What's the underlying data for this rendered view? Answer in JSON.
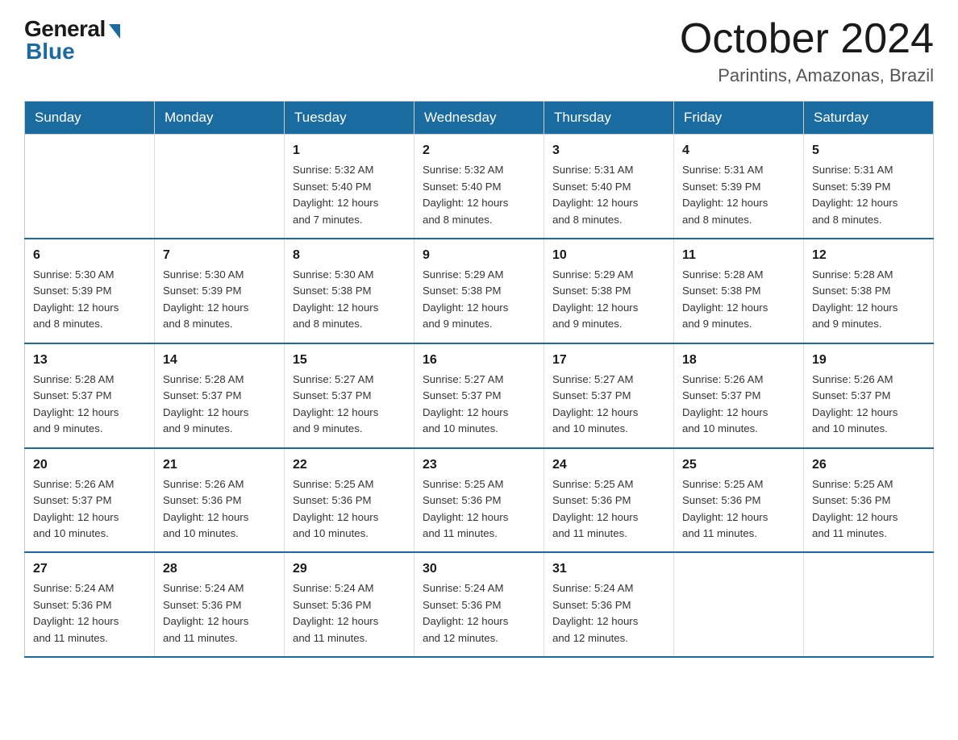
{
  "header": {
    "logo": {
      "general": "General",
      "blue": "Blue"
    },
    "title": "October 2024",
    "location": "Parintins, Amazonas, Brazil"
  },
  "calendar": {
    "days_of_week": [
      "Sunday",
      "Monday",
      "Tuesday",
      "Wednesday",
      "Thursday",
      "Friday",
      "Saturday"
    ],
    "weeks": [
      [
        {
          "day": "",
          "info": ""
        },
        {
          "day": "",
          "info": ""
        },
        {
          "day": "1",
          "info": "Sunrise: 5:32 AM\nSunset: 5:40 PM\nDaylight: 12 hours\nand 7 minutes."
        },
        {
          "day": "2",
          "info": "Sunrise: 5:32 AM\nSunset: 5:40 PM\nDaylight: 12 hours\nand 8 minutes."
        },
        {
          "day": "3",
          "info": "Sunrise: 5:31 AM\nSunset: 5:40 PM\nDaylight: 12 hours\nand 8 minutes."
        },
        {
          "day": "4",
          "info": "Sunrise: 5:31 AM\nSunset: 5:39 PM\nDaylight: 12 hours\nand 8 minutes."
        },
        {
          "day": "5",
          "info": "Sunrise: 5:31 AM\nSunset: 5:39 PM\nDaylight: 12 hours\nand 8 minutes."
        }
      ],
      [
        {
          "day": "6",
          "info": "Sunrise: 5:30 AM\nSunset: 5:39 PM\nDaylight: 12 hours\nand 8 minutes."
        },
        {
          "day": "7",
          "info": "Sunrise: 5:30 AM\nSunset: 5:39 PM\nDaylight: 12 hours\nand 8 minutes."
        },
        {
          "day": "8",
          "info": "Sunrise: 5:30 AM\nSunset: 5:38 PM\nDaylight: 12 hours\nand 8 minutes."
        },
        {
          "day": "9",
          "info": "Sunrise: 5:29 AM\nSunset: 5:38 PM\nDaylight: 12 hours\nand 9 minutes."
        },
        {
          "day": "10",
          "info": "Sunrise: 5:29 AM\nSunset: 5:38 PM\nDaylight: 12 hours\nand 9 minutes."
        },
        {
          "day": "11",
          "info": "Sunrise: 5:28 AM\nSunset: 5:38 PM\nDaylight: 12 hours\nand 9 minutes."
        },
        {
          "day": "12",
          "info": "Sunrise: 5:28 AM\nSunset: 5:38 PM\nDaylight: 12 hours\nand 9 minutes."
        }
      ],
      [
        {
          "day": "13",
          "info": "Sunrise: 5:28 AM\nSunset: 5:37 PM\nDaylight: 12 hours\nand 9 minutes."
        },
        {
          "day": "14",
          "info": "Sunrise: 5:28 AM\nSunset: 5:37 PM\nDaylight: 12 hours\nand 9 minutes."
        },
        {
          "day": "15",
          "info": "Sunrise: 5:27 AM\nSunset: 5:37 PM\nDaylight: 12 hours\nand 9 minutes."
        },
        {
          "day": "16",
          "info": "Sunrise: 5:27 AM\nSunset: 5:37 PM\nDaylight: 12 hours\nand 10 minutes."
        },
        {
          "day": "17",
          "info": "Sunrise: 5:27 AM\nSunset: 5:37 PM\nDaylight: 12 hours\nand 10 minutes."
        },
        {
          "day": "18",
          "info": "Sunrise: 5:26 AM\nSunset: 5:37 PM\nDaylight: 12 hours\nand 10 minutes."
        },
        {
          "day": "19",
          "info": "Sunrise: 5:26 AM\nSunset: 5:37 PM\nDaylight: 12 hours\nand 10 minutes."
        }
      ],
      [
        {
          "day": "20",
          "info": "Sunrise: 5:26 AM\nSunset: 5:37 PM\nDaylight: 12 hours\nand 10 minutes."
        },
        {
          "day": "21",
          "info": "Sunrise: 5:26 AM\nSunset: 5:36 PM\nDaylight: 12 hours\nand 10 minutes."
        },
        {
          "day": "22",
          "info": "Sunrise: 5:25 AM\nSunset: 5:36 PM\nDaylight: 12 hours\nand 10 minutes."
        },
        {
          "day": "23",
          "info": "Sunrise: 5:25 AM\nSunset: 5:36 PM\nDaylight: 12 hours\nand 11 minutes."
        },
        {
          "day": "24",
          "info": "Sunrise: 5:25 AM\nSunset: 5:36 PM\nDaylight: 12 hours\nand 11 minutes."
        },
        {
          "day": "25",
          "info": "Sunrise: 5:25 AM\nSunset: 5:36 PM\nDaylight: 12 hours\nand 11 minutes."
        },
        {
          "day": "26",
          "info": "Sunrise: 5:25 AM\nSunset: 5:36 PM\nDaylight: 12 hours\nand 11 minutes."
        }
      ],
      [
        {
          "day": "27",
          "info": "Sunrise: 5:24 AM\nSunset: 5:36 PM\nDaylight: 12 hours\nand 11 minutes."
        },
        {
          "day": "28",
          "info": "Sunrise: 5:24 AM\nSunset: 5:36 PM\nDaylight: 12 hours\nand 11 minutes."
        },
        {
          "day": "29",
          "info": "Sunrise: 5:24 AM\nSunset: 5:36 PM\nDaylight: 12 hours\nand 11 minutes."
        },
        {
          "day": "30",
          "info": "Sunrise: 5:24 AM\nSunset: 5:36 PM\nDaylight: 12 hours\nand 12 minutes."
        },
        {
          "day": "31",
          "info": "Sunrise: 5:24 AM\nSunset: 5:36 PM\nDaylight: 12 hours\nand 12 minutes."
        },
        {
          "day": "",
          "info": ""
        },
        {
          "day": "",
          "info": ""
        }
      ]
    ]
  }
}
